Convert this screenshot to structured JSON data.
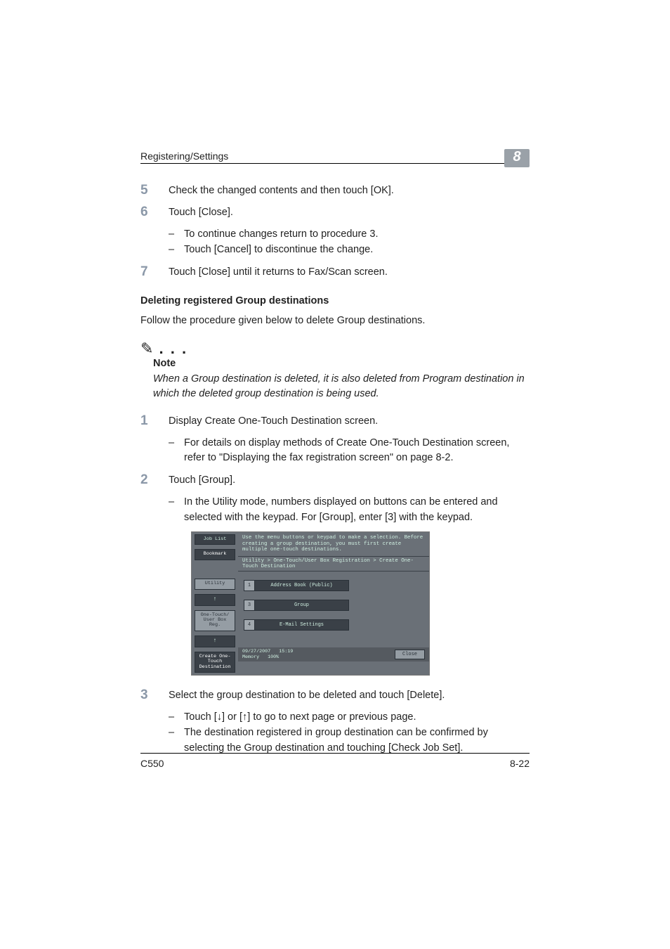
{
  "header": {
    "title": "Registering/Settings",
    "chapter": "8"
  },
  "steps_a": {
    "s5": {
      "num": "5",
      "text": "Check the changed contents and then touch [OK]."
    },
    "s6": {
      "num": "6",
      "text": "Touch [Close].",
      "subs": [
        "To continue changes return to procedure 3.",
        "Touch [Cancel] to discontinue the change."
      ]
    },
    "s7": {
      "num": "7",
      "text": "Touch [Close] until it returns to Fax/Scan screen."
    }
  },
  "section": {
    "heading": "Deleting registered Group destinations",
    "intro": "Follow the procedure given below to delete Group destinations."
  },
  "note": {
    "label": "Note",
    "body": "When a Group destination is deleted, it is also deleted from Program destination in which the deleted group destination is being used."
  },
  "steps_b": {
    "s1": {
      "num": "1",
      "text": "Display Create One-Touch Destination screen.",
      "subs": [
        "For details on display methods of Create One-Touch Destination screen, refer to \"Displaying the fax registration screen\" on page 8-2."
      ]
    },
    "s2": {
      "num": "2",
      "text": "Touch [Group].",
      "subs": [
        "In the Utility mode, numbers displayed on buttons can be entered and selected with the keypad. For [Group], enter [3] with the keypad."
      ]
    },
    "s3": {
      "num": "3",
      "text": "Select the group destination to be deleted and touch [Delete].",
      "subs": [
        "Touch [↓] or [↑] to go to next page or previous page.",
        "The destination registered in group destination can be confirmed by selecting the Group destination and touching [Check Job Set]."
      ]
    }
  },
  "screenshot": {
    "left_tabs": {
      "job_list": "Job List",
      "bookmark": "Bookmark"
    },
    "hint": "Use the menu buttons or keypad to make a selection.\nBefore creating a group destination, you must first create multiple\none-touch destinations.",
    "breadcrumb": "Utility > One-Touch/User Box Registration > Create One-Touch Destination",
    "left_nav": {
      "utility": "Utility",
      "one_touch": "One-Touch/\nUser Box Reg.",
      "create": "Create One-Touch\nDestination"
    },
    "options": [
      {
        "num": "1",
        "label": "Address Book (Public)"
      },
      {
        "num": "3",
        "label": "Group"
      },
      {
        "num": "4",
        "label": "E-Mail Settings"
      }
    ],
    "foot": {
      "date": "09/27/2007",
      "time": "15:19",
      "mem_label": "Memory",
      "mem_val": "100%",
      "close": "Close"
    }
  },
  "footer": {
    "model": "C550",
    "page": "8-22"
  }
}
